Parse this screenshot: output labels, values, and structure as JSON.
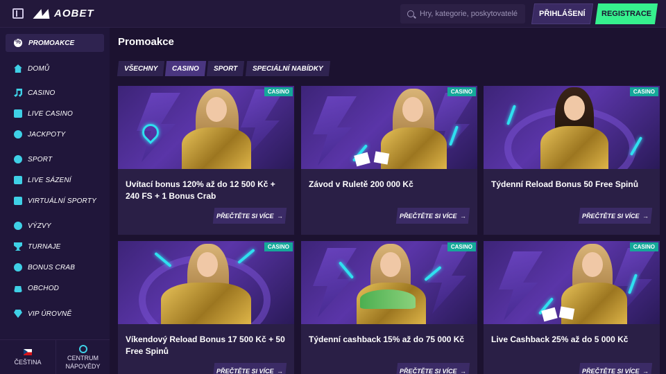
{
  "header": {
    "logo": "AOBET",
    "search_placeholder": "Hry, kategorie, poskytovatelé",
    "login_label": "PŘIHLÁŠENÍ",
    "register_label": "REGISTRACE"
  },
  "sidebar": {
    "items": [
      {
        "label": "PROMOAKCE",
        "icon": "promo-icon"
      },
      {
        "label": "DOMŮ",
        "icon": "home-icon"
      },
      {
        "label": "CASINO",
        "icon": "casino-icon"
      },
      {
        "label": "LIVE CASINO",
        "icon": "live-casino-icon"
      },
      {
        "label": "JACKPOTY",
        "icon": "jackpot-icon"
      },
      {
        "label": "SPORT",
        "icon": "sport-icon"
      },
      {
        "label": "LIVE SÁZENÍ",
        "icon": "live-betting-icon"
      },
      {
        "label": "VIRTUÁLNÍ SPORTY",
        "icon": "virtual-sports-icon"
      },
      {
        "label": "VÝZVY",
        "icon": "challenges-icon"
      },
      {
        "label": "TURNAJE",
        "icon": "trophy-icon"
      },
      {
        "label": "BONUS CRAB",
        "icon": "crab-icon"
      },
      {
        "label": "OBCHOD",
        "icon": "shop-icon"
      },
      {
        "label": "VIP ÚROVNĚ",
        "icon": "vip-diamond-icon"
      }
    ],
    "language": "ČEŠTINA",
    "help_line1": "CENTRUM",
    "help_line2": "NÁPOVĚDY"
  },
  "main": {
    "title": "Promoakce",
    "tabs": [
      {
        "label": "VŠECHNY",
        "active": false
      },
      {
        "label": "CASINO",
        "active": true
      },
      {
        "label": "SPORT",
        "active": false
      },
      {
        "label": "SPECIÁLNÍ NABÍDKY",
        "active": false
      }
    ],
    "cards": [
      {
        "badge": "CASINO",
        "title": "Uvítací bonus 120% až do 12 500 Kč + 240 FS + 1 Bonus Crab",
        "cta": "PŘEČTĚTE SI VÍCE"
      },
      {
        "badge": "CASINO",
        "title": "Závod v Ruletě 200 000 Kč",
        "cta": "PŘEČTĚTE SI VÍCE"
      },
      {
        "badge": "CASINO",
        "title": "Týdenní Reload Bonus 50 Free Spinů",
        "cta": "PŘEČTĚTE SI VÍCE"
      },
      {
        "badge": "CASINO",
        "title": "Víkendový Reload Bonus 17 500 Kč + 50 Free Spinů",
        "cta": "PŘEČTĚTE SI VÍCE"
      },
      {
        "badge": "CASINO",
        "title": "Týdenní cashback 15% až do 75 000 Kč",
        "cta": "PŘEČTĚTE SI VÍCE"
      },
      {
        "badge": "CASINO",
        "title": "Live Cashback 25% až do 5 000 Kč",
        "cta": "PŘEČTĚTE SI VÍCE"
      }
    ]
  },
  "colors": {
    "accent_green": "#36f08e",
    "badge_teal": "#15a89a",
    "icon_cyan": "#3fd0e6",
    "background": "#1c1230"
  }
}
